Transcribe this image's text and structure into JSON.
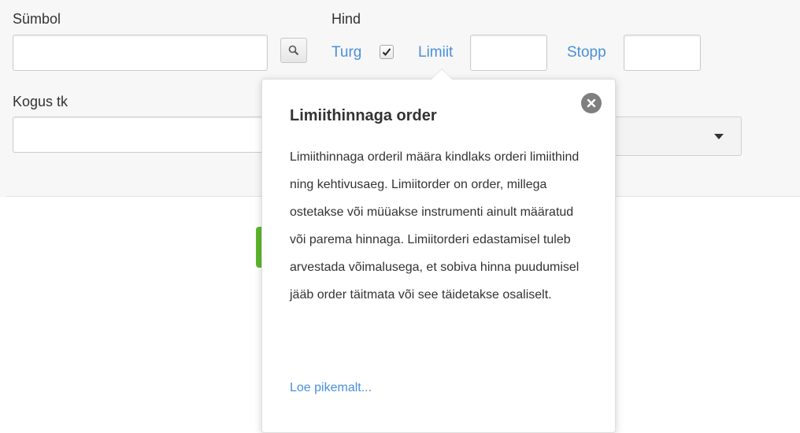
{
  "form": {
    "symbol_label": "Sümbol",
    "symbol_value": "",
    "price_label": "Hind",
    "market_label": "Turg",
    "market_checked": true,
    "limit_label": "Limiit",
    "limit_value": "",
    "stop_label": "Stopp",
    "stop_value": "",
    "quantity_label": "Kogus tk",
    "quantity_value": ""
  },
  "popover": {
    "title": "Limiithinnaga order",
    "body": "Limiithinnaga orderil määra kindlaks orderi limiithind ning kehtivusaeg. Limiitorder on order, millega ostetakse või müüakse instrumenti ainult määratud või parema hinnaga. Limiitorderi edastamisel tuleb arvestada võimalusega, et sobiva hinna puudumisel jääb order täitmata või see täidetakse osaliselt.",
    "link": "Loe pikemalt..."
  },
  "colors": {
    "link": "#4a90d9",
    "submit_button": "#5cb82c",
    "close_icon": "#7f7f7f"
  },
  "icons": [
    "search-icon",
    "checkmark-icon",
    "close-icon",
    "caret-down-icon"
  ]
}
